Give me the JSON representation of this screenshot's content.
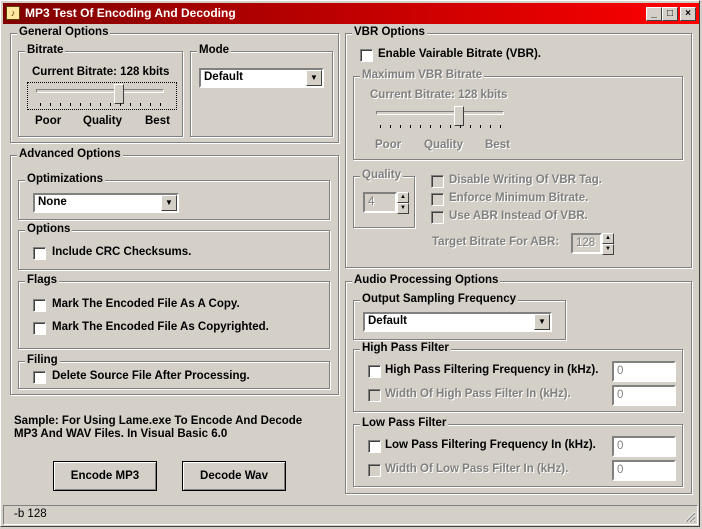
{
  "window": {
    "title": "MP3 Test Of Encoding And Decoding",
    "icon": "app-icon"
  },
  "general": {
    "title": "General Options",
    "bitrate_title": "Bitrate",
    "current_bitrate": "Current Bitrate: 128 kbits",
    "slider_labels": [
      "Poor",
      "Quality",
      "Best"
    ],
    "mode_title": "Mode",
    "mode_value": "Default"
  },
  "vbr": {
    "title": "VBR Options",
    "enable_label": "Enable Vairable Bitrate (VBR).",
    "max_title": "Maximum VBR Bitrate",
    "current_bitrate": "Current Bitrate: 128 kbits",
    "slider_labels": [
      "Poor",
      "Quality",
      "Best"
    ],
    "quality_title": "Quality",
    "quality_value": "4",
    "disable_tag": "Disable Writing Of VBR Tag.",
    "enforce_min": "Enforce Minimum Bitrate.",
    "use_abr": "Use ABR Instead Of VBR.",
    "target_label": "Target Bitrate For ABR:",
    "target_value": "128"
  },
  "advanced": {
    "title": "Advanced Options",
    "optimizations_title": "Optimizations",
    "optimizations_value": "None",
    "options_title": "Options",
    "crc_label": "Include CRC Checksums.",
    "flags_title": "Flags",
    "copy_label": "Mark The Encoded File As A Copy.",
    "copyrighted_label": "Mark The Encoded File As Copyrighted.",
    "filing_title": "Filing",
    "delete_label": "Delete Source File After Processing."
  },
  "audio": {
    "title": "Audio Processing Options",
    "osf_title": "Output Sampling Frequency",
    "osf_value": "Default",
    "hp_title": "High Pass Filter",
    "hp_freq_label": "High Pass Filtering Frequency in (kHz).",
    "hp_freq_value": "0",
    "hp_width_label": "Width Of High Pass Filter In (kHz).",
    "hp_width_value": "0",
    "lp_title": "Low Pass Filter",
    "lp_freq_label": "Low Pass Filtering Frequency In (kHz).",
    "lp_freq_value": "0",
    "lp_width_label": "Width Of Low Pass Filter In (kHz).",
    "lp_width_value": "0"
  },
  "sample_text_1": "Sample: For Using Lame.exe To Encode And Decode",
  "sample_text_2": "MP3 And WAV Files. In Visual Basic 6.0",
  "buttons": {
    "encode": "Encode MP3",
    "decode": "Decode Wav"
  },
  "status": "-b 128"
}
